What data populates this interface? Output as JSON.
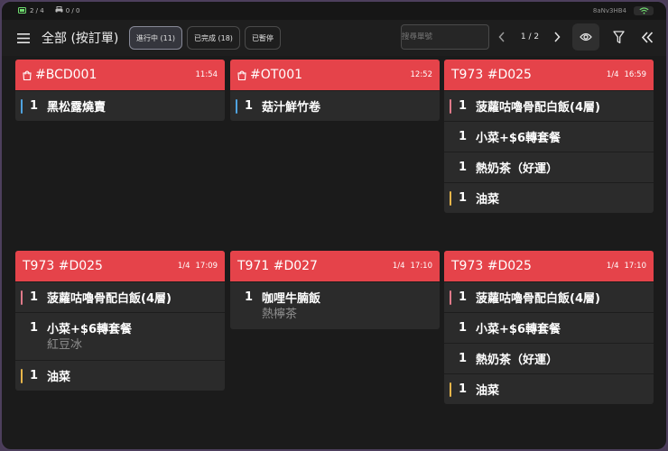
{
  "status_bar": {
    "battery_text": "2 / 4",
    "printer_text": "0 / 0",
    "device_id": "8aNv3HB4",
    "icons": {
      "battery": "battery-icon",
      "printer": "printer-icon",
      "wifi": "wifi-icon"
    }
  },
  "toolbar": {
    "title": "全部 (按訂單)",
    "tabs": [
      {
        "label": "進行中 (11)",
        "active": true
      },
      {
        "label": "已完成 (18)",
        "active": false
      },
      {
        "label": "已暫停",
        "active": false
      }
    ],
    "search_placeholder": "搜尋單號",
    "page_indicator": "1 / 2",
    "icons": {
      "menu": "menu-icon",
      "prev": "chevron-left-icon",
      "next": "chevron-right-icon",
      "eye": "eye-icon",
      "filter": "filter-icon",
      "collapse": "double-chevron-left-icon"
    }
  },
  "colors": {
    "header_red": "#e5434a",
    "bar_red": "#e5434a",
    "bar_blue": "#4fa3e0",
    "bar_yellow": "#e8b64a",
    "bar_pink": "#e07a8a"
  },
  "orders": [
    {
      "title": "#BCD001",
      "bag_icon": true,
      "count": "",
      "time": "11:54",
      "items": [
        {
          "qty": "1",
          "name": "黑松露燒賣",
          "bar": "#4fa3e0",
          "mods": []
        }
      ]
    },
    {
      "title": "#OT001",
      "bag_icon": true,
      "count": "",
      "time": "12:52",
      "items": [
        {
          "qty": "1",
          "name": "菇汁鮮竹卷",
          "bar": "#4fa3e0",
          "mods": []
        }
      ]
    },
    {
      "title": "T973 #D025",
      "bag_icon": false,
      "count": "1/4",
      "time": "16:59",
      "items": [
        {
          "qty": "1",
          "name": "菠蘿咕嚕骨配白飯(4層)",
          "bar": "#e07a8a",
          "mods": []
        },
        {
          "qty": "1",
          "name": "小菜+$6轉套餐",
          "bar": "",
          "mods": []
        },
        {
          "qty": "1",
          "name": "熱奶茶（好運）",
          "bar": "",
          "mods": []
        },
        {
          "qty": "1",
          "name": "油菜",
          "bar": "#e8b64a",
          "mods": []
        }
      ]
    },
    {
      "title": "T973 #D025",
      "bag_icon": false,
      "count": "1/4",
      "time": "17:09",
      "items": [
        {
          "qty": "1",
          "name": "菠蘿咕嚕骨配白飯(4層)",
          "bar": "#e07a8a",
          "mods": []
        },
        {
          "qty": "1",
          "name": "小菜+$6轉套餐",
          "bar": "",
          "mods": [
            "紅豆冰"
          ]
        },
        {
          "qty": "1",
          "name": "油菜",
          "bar": "#e8b64a",
          "mods": []
        }
      ]
    },
    {
      "title": "T971 #D027",
      "bag_icon": false,
      "count": "1/4",
      "time": "17:10",
      "items": [
        {
          "qty": "1",
          "name": "咖哩牛腩飯",
          "bar": "",
          "mods": [
            "熱檸茶"
          ]
        }
      ]
    },
    {
      "title": "T973 #D025",
      "bag_icon": false,
      "count": "1/4",
      "time": "17:10",
      "items": [
        {
          "qty": "1",
          "name": "菠蘿咕嚕骨配白飯(4層)",
          "bar": "#e07a8a",
          "mods": []
        },
        {
          "qty": "1",
          "name": "小菜+$6轉套餐",
          "bar": "",
          "mods": []
        },
        {
          "qty": "1",
          "name": "熱奶茶（好運）",
          "bar": "",
          "mods": []
        },
        {
          "qty": "1",
          "name": "油菜",
          "bar": "#e8b64a",
          "mods": []
        }
      ]
    }
  ]
}
